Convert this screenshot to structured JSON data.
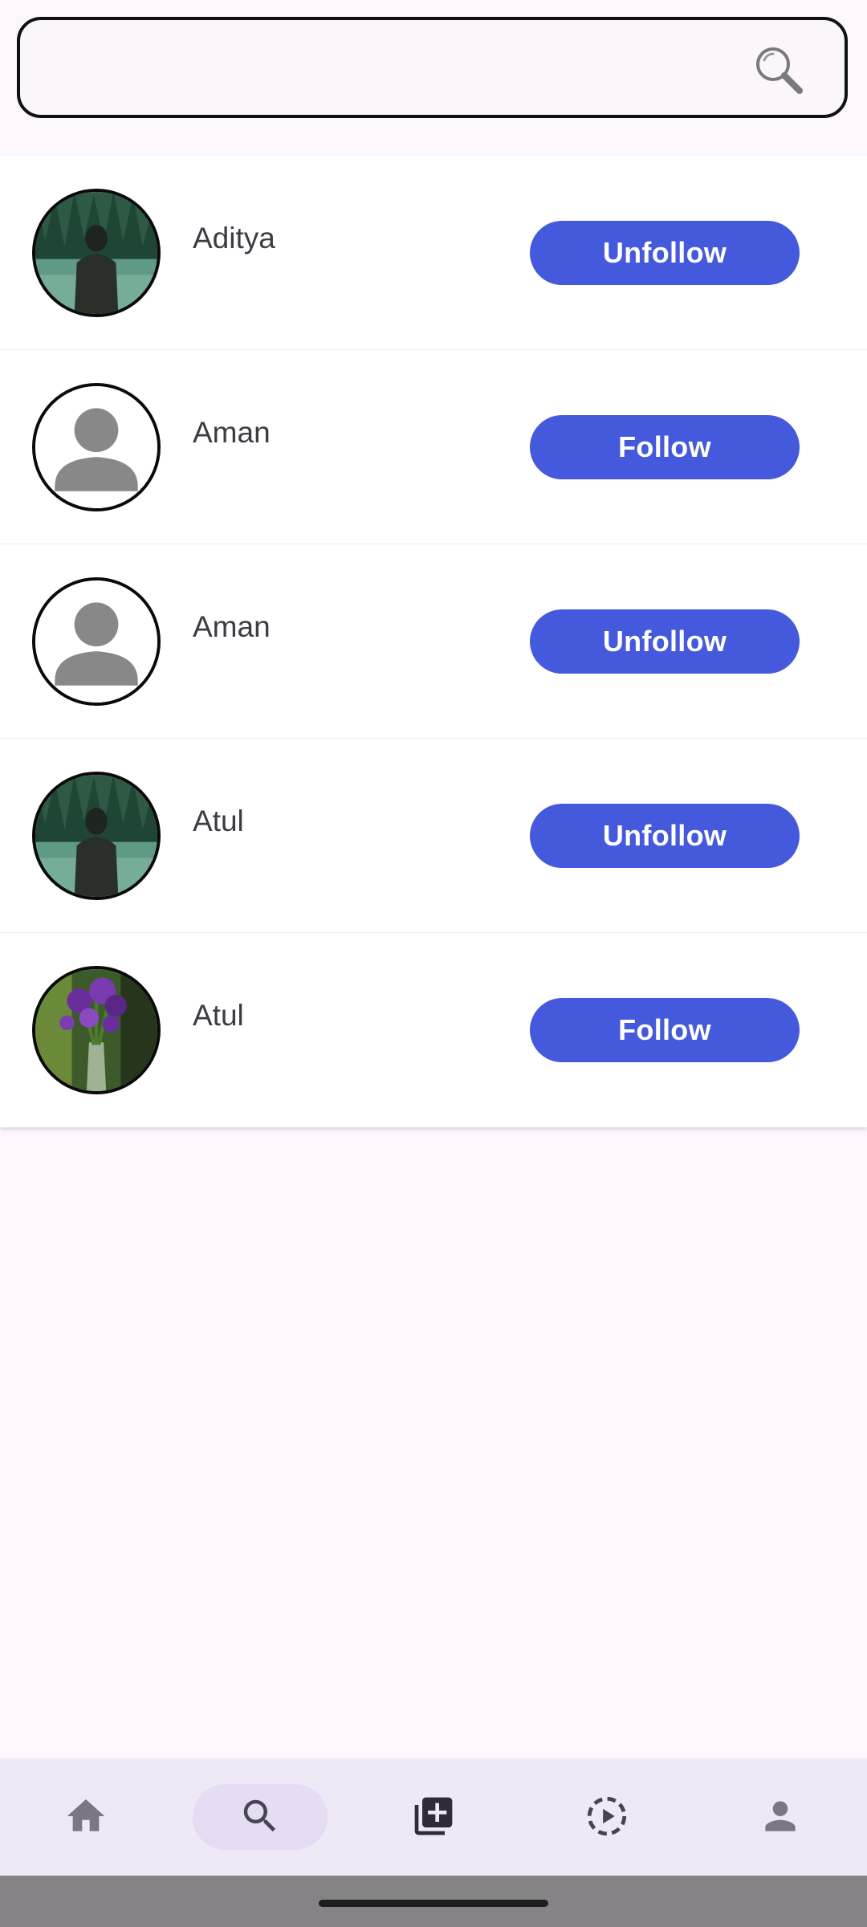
{
  "search": {
    "value": "",
    "placeholder": ""
  },
  "users": [
    {
      "name": "Aditya",
      "button": "Unfollow",
      "avatar": "photo-person-lake"
    },
    {
      "name": "Aman",
      "button": "Follow",
      "avatar": "default-person"
    },
    {
      "name": "Aman",
      "button": "Unfollow",
      "avatar": "default-person"
    },
    {
      "name": "Atul",
      "button": "Unfollow",
      "avatar": "photo-person-lake"
    },
    {
      "name": "Atul",
      "button": "Follow",
      "avatar": "photo-flowers"
    }
  ],
  "nav": {
    "items": [
      "home-icon",
      "search-icon",
      "add-post-icon",
      "reels-icon",
      "profile-icon"
    ],
    "active": "search-icon"
  },
  "colors": {
    "accent": "#4559dd",
    "background": "#fdf7fd",
    "navbar": "#efe9f6",
    "nav_active_pill": "#e6dcf3"
  }
}
